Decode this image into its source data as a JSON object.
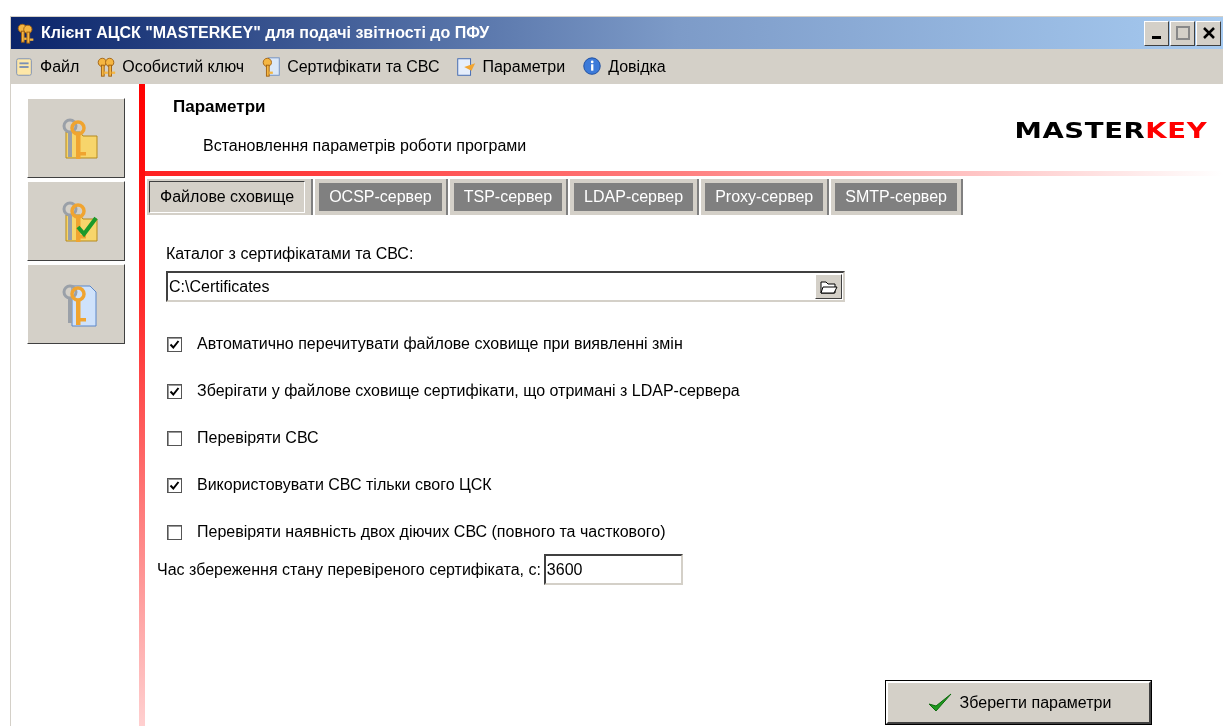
{
  "window": {
    "title": "Клієнт АЦСК \"MASTERKEY\" для подачі звітності до ПФУ"
  },
  "menu": [
    {
      "label": "Файл",
      "kind": "file"
    },
    {
      "label": "Особистий ключ",
      "kind": "key"
    },
    {
      "label": "Сертифікати та СВС",
      "kind": "certificate"
    },
    {
      "label": "Параметри",
      "kind": "settings"
    },
    {
      "label": "Довідка",
      "kind": "help"
    }
  ],
  "sidebar": {
    "buttons": [
      {
        "kind": "folder"
      },
      {
        "kind": "check"
      },
      {
        "kind": "document"
      }
    ]
  },
  "header": {
    "title": "Параметри",
    "subtitle": "Встановлення параметрів роботи програми",
    "logo": {
      "dark": "MASTER",
      "accent": "KEY"
    }
  },
  "tabs": [
    {
      "label": "Файлове сховище",
      "selected": true
    },
    {
      "label": "OCSP-сервер",
      "selected": false
    },
    {
      "label": "TSP-сервер",
      "selected": false
    },
    {
      "label": "LDAP-сервер",
      "selected": false
    },
    {
      "label": "Proxy-сервер",
      "selected": false
    },
    {
      "label": "SMTP-сервер",
      "selected": false
    }
  ],
  "directory": {
    "label": "Каталог з сертифікатами та СВС:",
    "value": "C:\\Certificates"
  },
  "options": [
    {
      "label": "Автоматично перечитувати файлове сховище при виявленні змін",
      "checked": true
    },
    {
      "label": "Зберігати у файлове сховище сертифікати, що отримані з LDAP-сервера",
      "checked": true
    },
    {
      "label": "Перевіряти СВС",
      "checked": false
    },
    {
      "label": "Використовувати СВС тільки свого ЦСК",
      "checked": true
    },
    {
      "label": "Перевіряти наявність двох діючих СВС (повного та часткового)",
      "checked": false
    }
  ],
  "cache_time": {
    "label": "Час збереження стану перевіреного сертифіката, с:",
    "value": "3600"
  },
  "save_button": {
    "label": "Зберегти параметри"
  }
}
